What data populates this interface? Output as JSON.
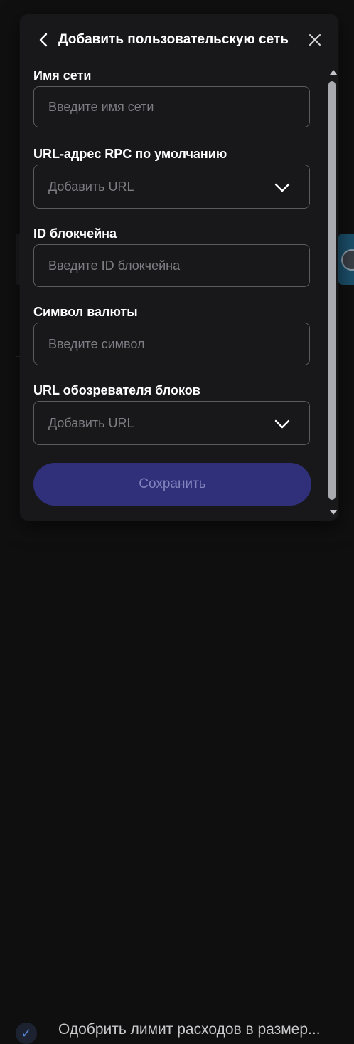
{
  "modal": {
    "title": "Добавить пользовательскую сеть",
    "back_icon": "chevron-left-icon",
    "close_icon": "close-icon",
    "fields": [
      {
        "label": "Имя сети",
        "placeholder": "Введите имя сети",
        "type": "text"
      },
      {
        "label": "URL-адрес RPC по умолчанию",
        "placeholder": "Добавить URL",
        "type": "dropdown",
        "icon": "chevron-down-icon"
      },
      {
        "label": "ID блокчейна",
        "placeholder": "Введите ID блокчейна",
        "type": "text"
      },
      {
        "label": "Символ валюты",
        "placeholder": "Введите символ",
        "type": "text"
      },
      {
        "label": "URL обозревателя блоков",
        "placeholder": "Добавить URL",
        "type": "dropdown",
        "icon": "chevron-down-icon"
      }
    ],
    "save_label": "Сохранить"
  },
  "background": {
    "bottom_text": "Одобрить лимит расходов в размер...",
    "check_icon": "checkmark-icon"
  },
  "colors": {
    "modal_bg": "#18181b",
    "input_border": "#5a5a60",
    "save_button_bg": "#2f2f7a",
    "save_button_text": "#8282bd",
    "placeholder": "#7d7d83"
  }
}
